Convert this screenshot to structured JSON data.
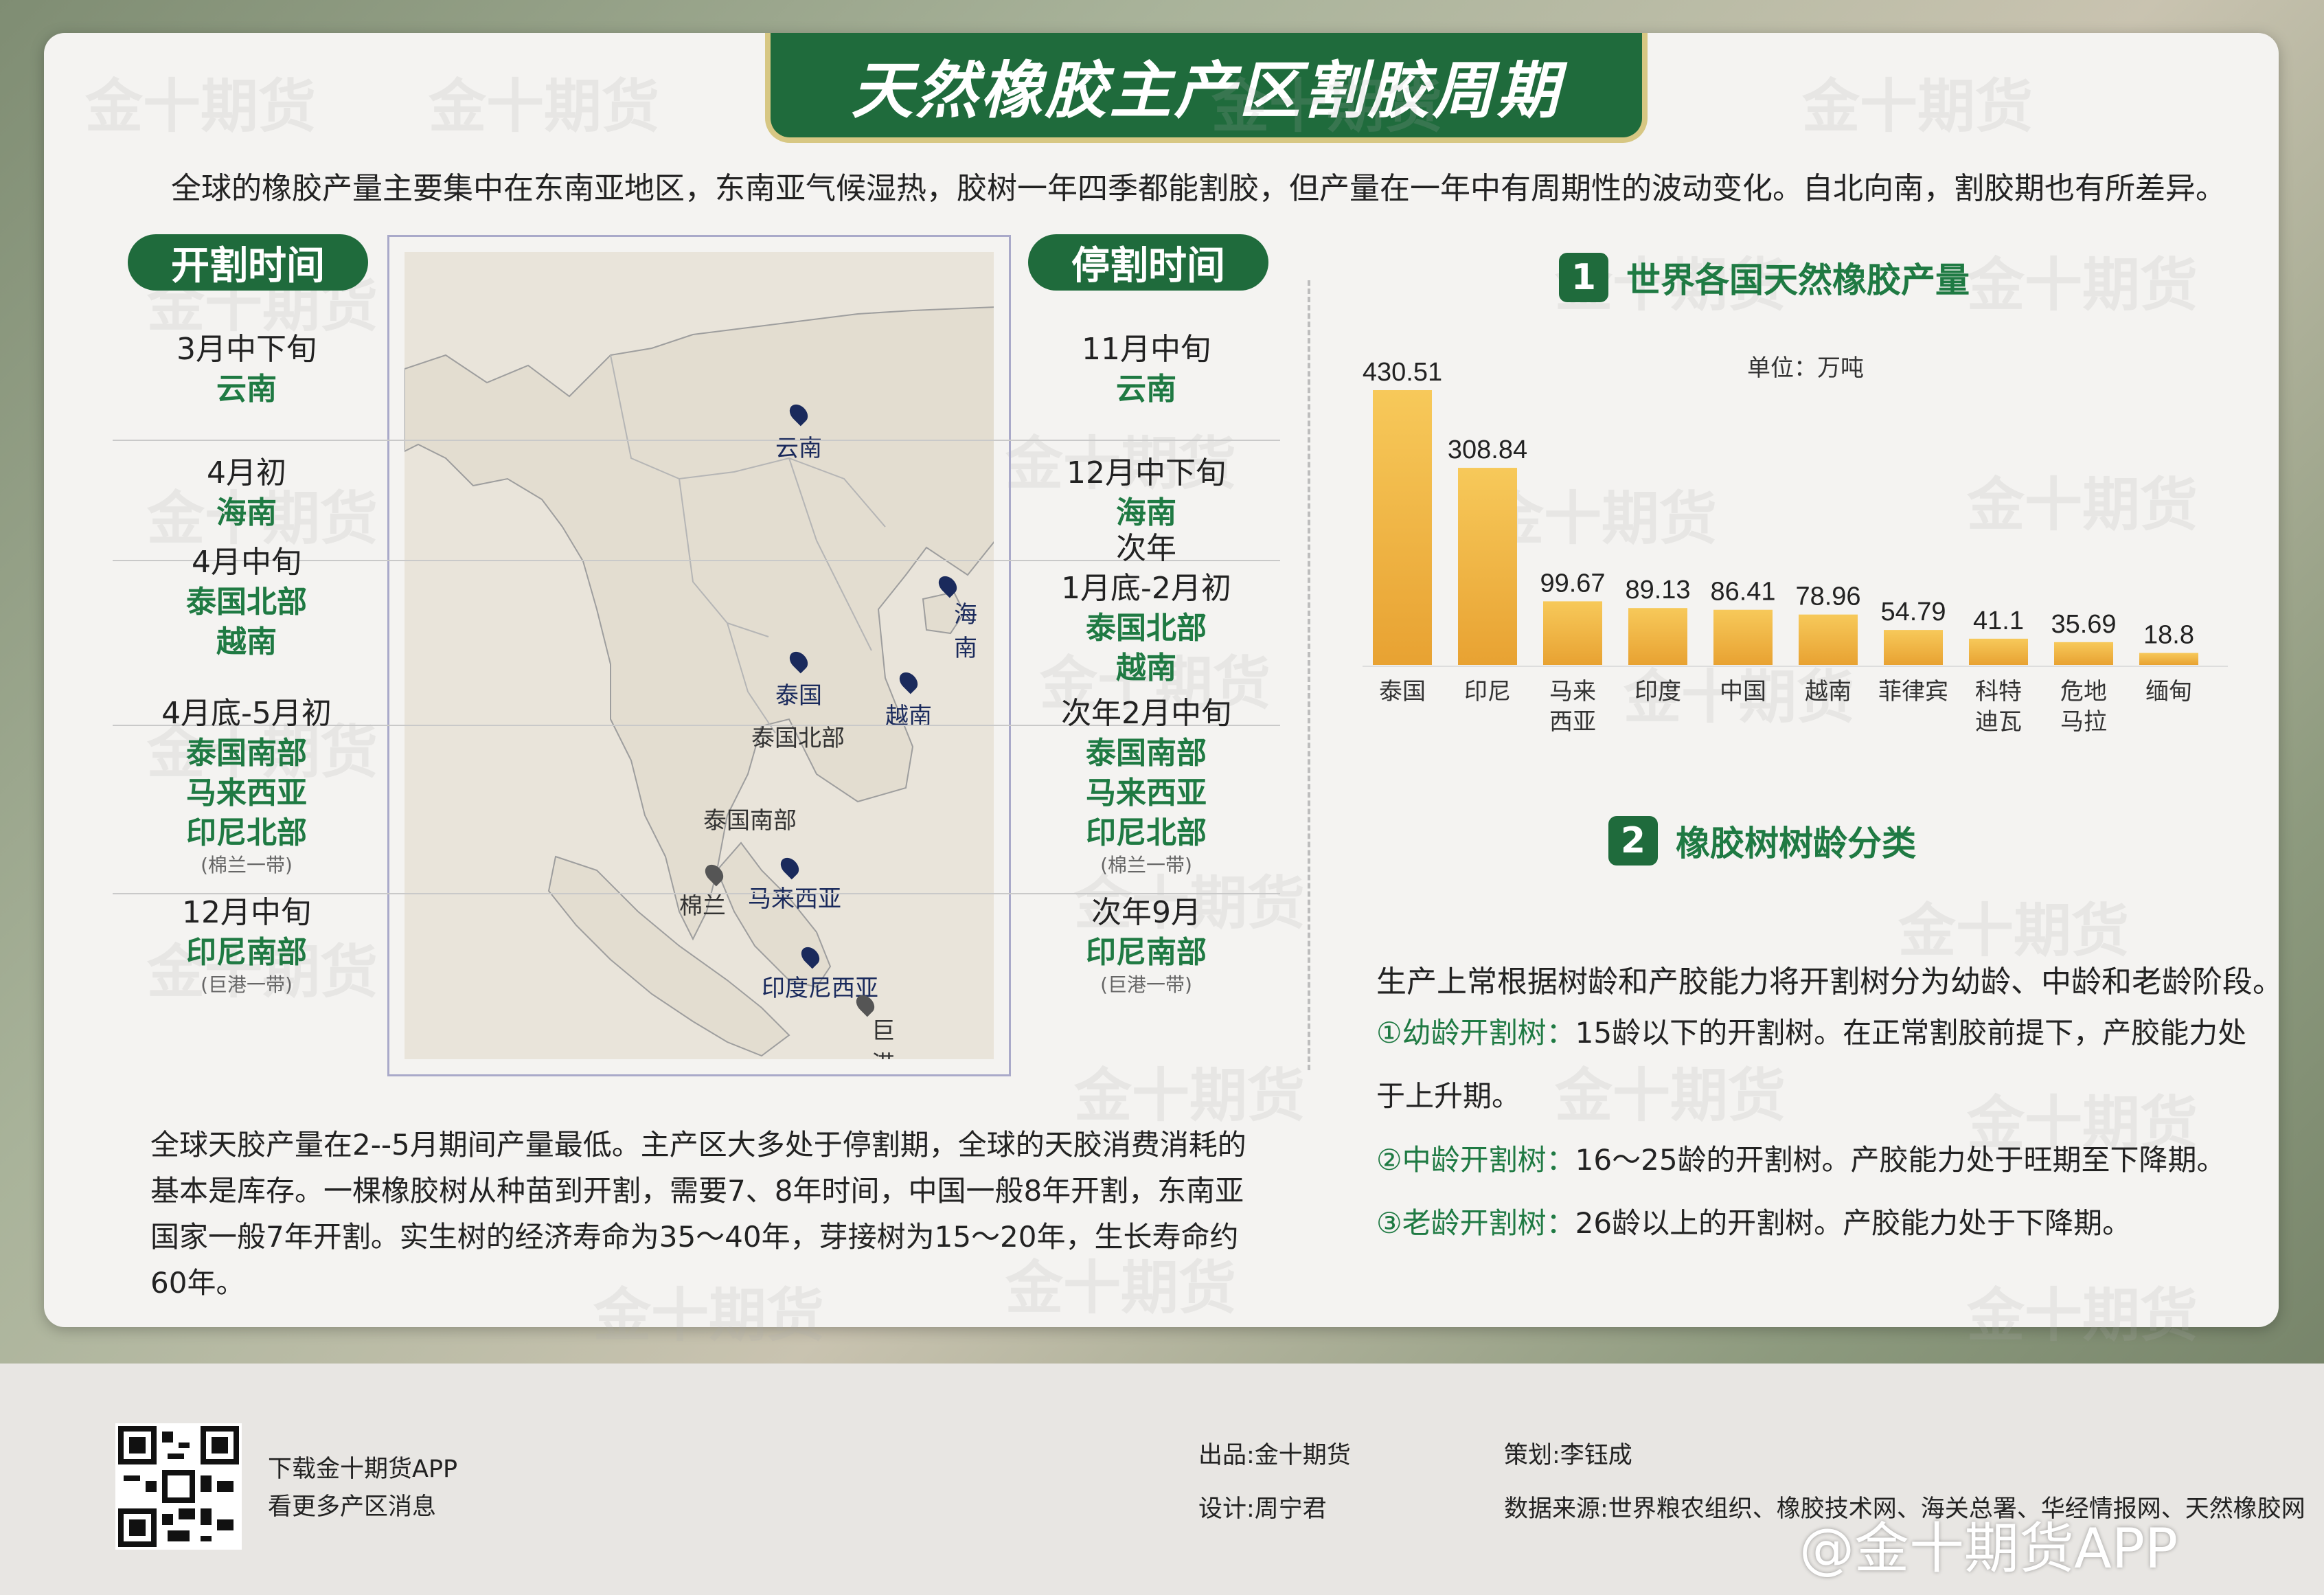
{
  "title": "天然橡胶主产区割胶周期",
  "intro": "全球的橡胶产量主要集中在东南亚地区，东南亚气候湿热，胶树一年四季都能割胶，但产量在一年中有周期性的波动变化。自北向南，割胶期也有所差异。",
  "start_header": "开割时间",
  "stop_header": "停割时间",
  "start_rows": [
    {
      "time": "3月中下旬",
      "regions": [
        "云南"
      ],
      "note": ""
    },
    {
      "time": "4月初",
      "regions": [
        "海南"
      ],
      "note": ""
    },
    {
      "time": "4月中旬",
      "regions": [
        "泰国北部",
        "越南"
      ],
      "note": ""
    },
    {
      "time": "4月底-5月初",
      "regions": [
        "泰国南部",
        "马来西亚",
        "印尼北部"
      ],
      "note": "(棉兰一带)"
    },
    {
      "time": "12月中旬",
      "regions": [
        "印尼南部"
      ],
      "note": "(巨港一带)"
    }
  ],
  "stop_rows": [
    {
      "time": "11月中旬",
      "regions": [
        "云南"
      ],
      "note": ""
    },
    {
      "time": "12月中下旬",
      "regions": [
        "海南"
      ],
      "note": ""
    },
    {
      "time": "次年\n1月底-2月初",
      "regions": [
        "泰国北部",
        "越南"
      ],
      "note": ""
    },
    {
      "time": "次年2月中旬",
      "regions": [
        "泰国南部",
        "马来西亚",
        "印尼北部"
      ],
      "note": "(棉兰一带)"
    },
    {
      "time": "次年9月",
      "regions": [
        "印尼南部"
      ],
      "note": "(巨港一带)"
    }
  ],
  "map_labels": {
    "yunnan": "云南",
    "hainan": "海南",
    "thailand": "泰国",
    "thailand_north": "泰国北部",
    "vietnam": "越南",
    "thailand_south": "泰国南部",
    "medan": "棉兰",
    "malaysia": "马来西亚",
    "indonesia": "印度尼西亚",
    "palembang": "巨港"
  },
  "bottom_text": "全球天胶产量在2--5月期间产量最低。主产区大多处于停割期，全球的天胶消费消耗的基本是库存。一棵橡胶树从种苗到开割，需要7、8年时间，中国一般8年开割，东南亚国家一般7年开割。实生树的经济寿命为35～40年，芽接树为15～20年，生长寿命约60年。",
  "section1": {
    "num": "1",
    "title": "世界各国天然橡胶产量",
    "unit": "单位：万吨"
  },
  "chart_data": {
    "type": "bar",
    "title": "世界各国天然橡胶产量",
    "unit": "单位：万吨",
    "categories": [
      "泰国",
      "印尼",
      "马来\n西亚",
      "印度",
      "中国",
      "越南",
      "菲律宾",
      "科特\n迪瓦",
      "危地\n马拉",
      "缅甸"
    ],
    "values": [
      430.51,
      308.84,
      99.67,
      89.13,
      86.41,
      78.96,
      54.79,
      41.1,
      35.69,
      18.8
    ],
    "value_labels": [
      "430.51",
      "308.84",
      "99.67",
      "89.13",
      "86.41",
      "78.96",
      "54.79",
      "41.1",
      "35.69",
      "18.8"
    ],
    "colors": {
      "bar_top": "#f7c95a",
      "bar_bottom": "#e8a232"
    }
  },
  "section2": {
    "num": "2",
    "title": "橡胶树树龄分类"
  },
  "section2_lead": "生产上常根据树龄和产胶能力将开割树分为幼龄、中龄和老龄阶段。",
  "age_items": [
    {
      "label": "①幼龄开割树：",
      "text": "15龄以下的开割树。在正常割胶前提下，产胶能力处于上升期。"
    },
    {
      "label": "②中龄开割树：",
      "text": "16～25龄的开割树。产胶能力处于旺期至下降期。"
    },
    {
      "label": "③老龄开割树：",
      "text": "26龄以上的开割树。产胶能力处于下降期。"
    }
  ],
  "footer": {
    "download": "下载金十期货APP",
    "more": "看更多产区消息",
    "producer": "出品:金十期货",
    "planner": "策划:李钰成",
    "designer": "设计:周宁君",
    "source": "数据来源:世界粮农组织、橡胶技术网、海关总署、华经情报网、天然橡胶网",
    "weibo": "@金十期货APP"
  },
  "watermark": "金十期货",
  "colors": {
    "green": "#1f6b3c",
    "green_text": "#1f7a43",
    "gold": "#d7c783"
  }
}
